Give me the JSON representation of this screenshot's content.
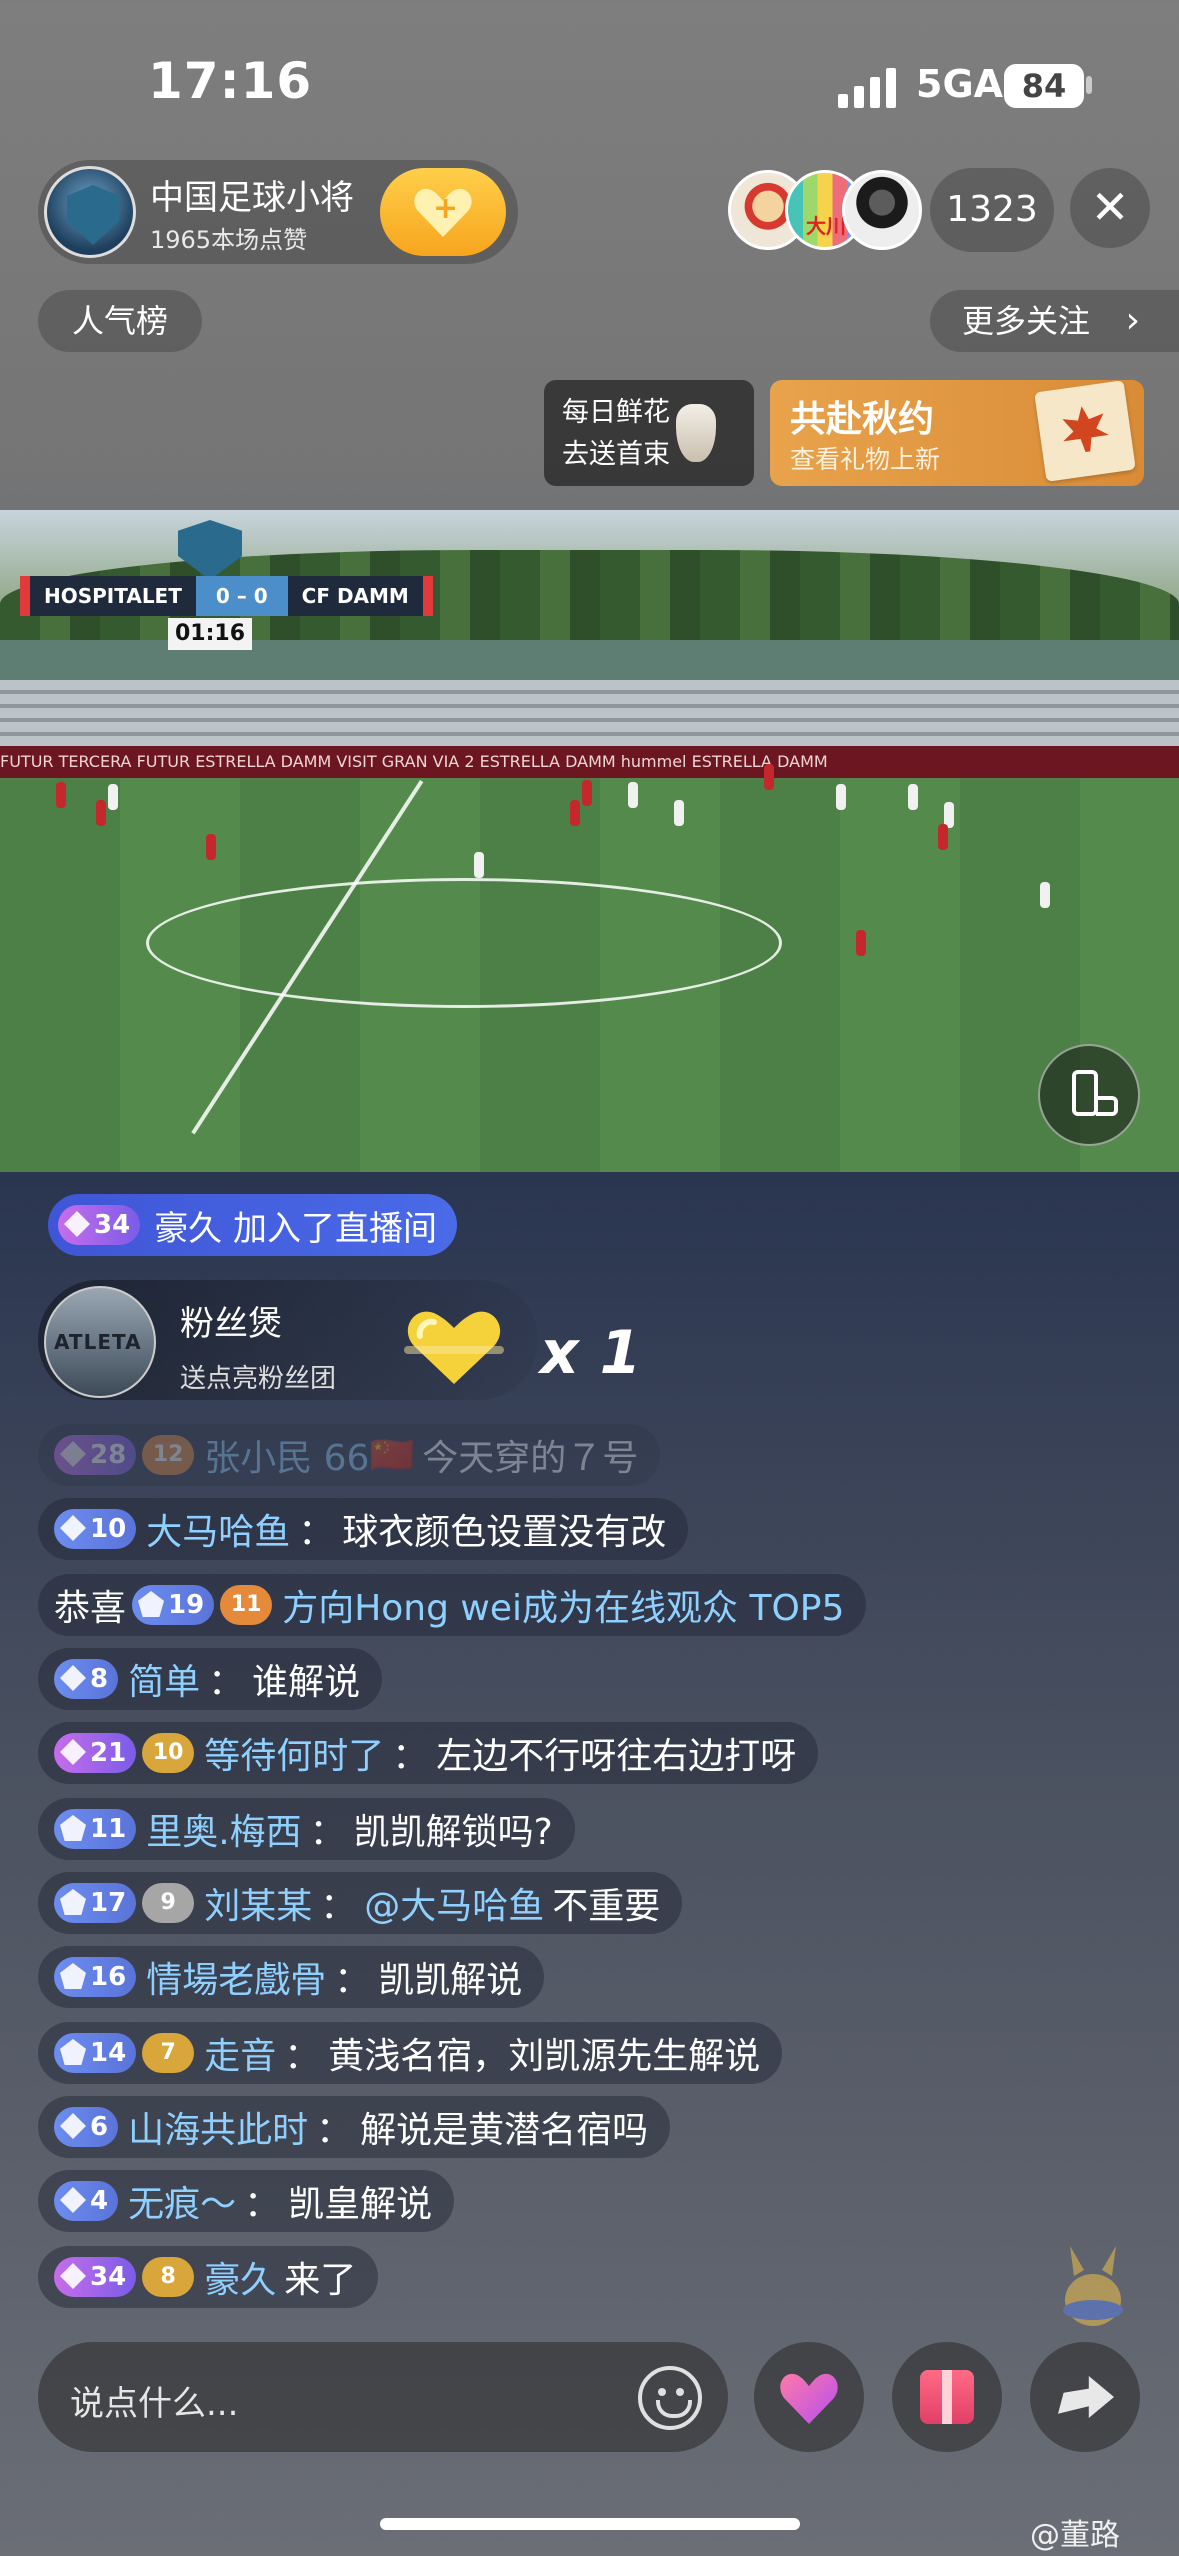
{
  "status_bar": {
    "time": "17:16",
    "network": "5GA",
    "battery": "84"
  },
  "host": {
    "name": "中国足球小将",
    "likes": "1965本场点赞"
  },
  "audience": {
    "count": "1323",
    "viewer2_text": "大川"
  },
  "popularity_label": "人气榜",
  "more_follow_label": "更多关注",
  "flower_card": {
    "line1": "每日鲜花",
    "line2": "去送首束"
  },
  "autumn_card": {
    "title": "共赴秋约",
    "subtitle": "查看礼物上新"
  },
  "scoreboard": {
    "home": "HOSPITALET",
    "score": "0 – 0",
    "away": "CF DAMM",
    "time": "01:16"
  },
  "ad_board_text": "FUTUR    TERCERA    FUTUR    ESTRELLA DAMM    VISIT    GRAN VIA 2    ESTRELLA DAMM    hummel    ESTRELLA DAMM",
  "join_notice": {
    "level": "34",
    "user": "豪久",
    "text": "加入了直播间"
  },
  "gift": {
    "name": "粉丝煲",
    "subtitle": "送点亮粉丝团",
    "count": "x 1",
    "avatar_text": "ATLETA"
  },
  "chat": [
    {
      "level": "28",
      "fan": "12",
      "user": "张小民 66",
      "flag": "🇨🇳",
      "msg": "今天穿的７号"
    },
    {
      "level": "10",
      "user": "大马哈鱼",
      "msg": "球衣颜色设置没有改"
    },
    {
      "prefix": "恭喜",
      "level": "19",
      "fan": "11",
      "user": "方向Hong wei成为在线观众 TOP5"
    },
    {
      "level": "8",
      "user": "简单",
      "msg": "谁解说"
    },
    {
      "level": "21",
      "fan": "10",
      "user": "等待何时了",
      "msg": "左边不行呀往右边打呀"
    },
    {
      "level": "11",
      "user": "里奥.梅西",
      "msg": "凯凯解锁吗?"
    },
    {
      "level": "17",
      "fan": "9",
      "user": "刘某某",
      "msg_highlight": "@大马哈鱼",
      "msg": "不重要"
    },
    {
      "level": "16",
      "user": "情場老戲骨",
      "msg": "凯凯解说"
    },
    {
      "level": "14",
      "fan": "7",
      "user": "走音",
      "msg": "黄浅名宿，刘凯源先生解说"
    },
    {
      "level": "6",
      "user": "山海共此时",
      "msg": "解说是黄潜名宿吗"
    },
    {
      "level": "4",
      "user": "无痕～",
      "msg": "凯皇解说"
    },
    {
      "level": "34",
      "fan": "8",
      "user": "豪久",
      "msg": "来了"
    }
  ],
  "input_placeholder": "说点什么...",
  "watermark": "@董路"
}
